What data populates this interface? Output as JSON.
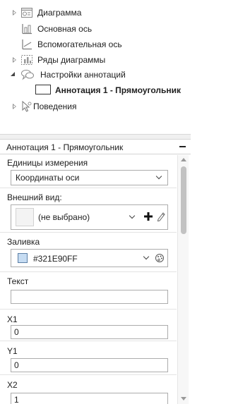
{
  "tree": {
    "items": [
      {
        "label": "Диаграмма",
        "icon": "chart-icon",
        "expander": "collapsed"
      },
      {
        "label": "Основная ось",
        "icon": "axis-icon",
        "expander": "none"
      },
      {
        "label": "Вспомогательная ось",
        "icon": "secondary-axis-icon",
        "expander": "none"
      },
      {
        "label": "Ряды диаграммы",
        "icon": "series-icon",
        "expander": "collapsed"
      },
      {
        "label": "Настройки аннотаций",
        "icon": "annotations-icon",
        "expander": "expanded"
      },
      {
        "label": "Аннотация 1 - Прямоугольник",
        "icon": "rectangle-icon",
        "expander": "none",
        "selected": true
      },
      {
        "label": "Поведения",
        "icon": "behavior-icon",
        "expander": "collapsed"
      }
    ]
  },
  "properties": {
    "title": "Аннотация 1 - Прямоугольник",
    "units": {
      "label": "Единицы измерения",
      "value": "Координаты оси"
    },
    "appearance": {
      "label": "Внешний вид:",
      "value": "(не выбрано)"
    },
    "fill": {
      "label": "Заливка",
      "value": "#321E90FF",
      "swatch_color": "#c6dcf2"
    },
    "text": {
      "label": "Текст",
      "value": ""
    },
    "x1": {
      "label": "X1",
      "value": "0"
    },
    "y1": {
      "label": "Y1",
      "value": "0"
    },
    "x2": {
      "label": "X2",
      "value": "1"
    }
  },
  "colors": {
    "accent": "#0078d7",
    "selected_text": "#1e1e1e",
    "border": "#acacac"
  }
}
